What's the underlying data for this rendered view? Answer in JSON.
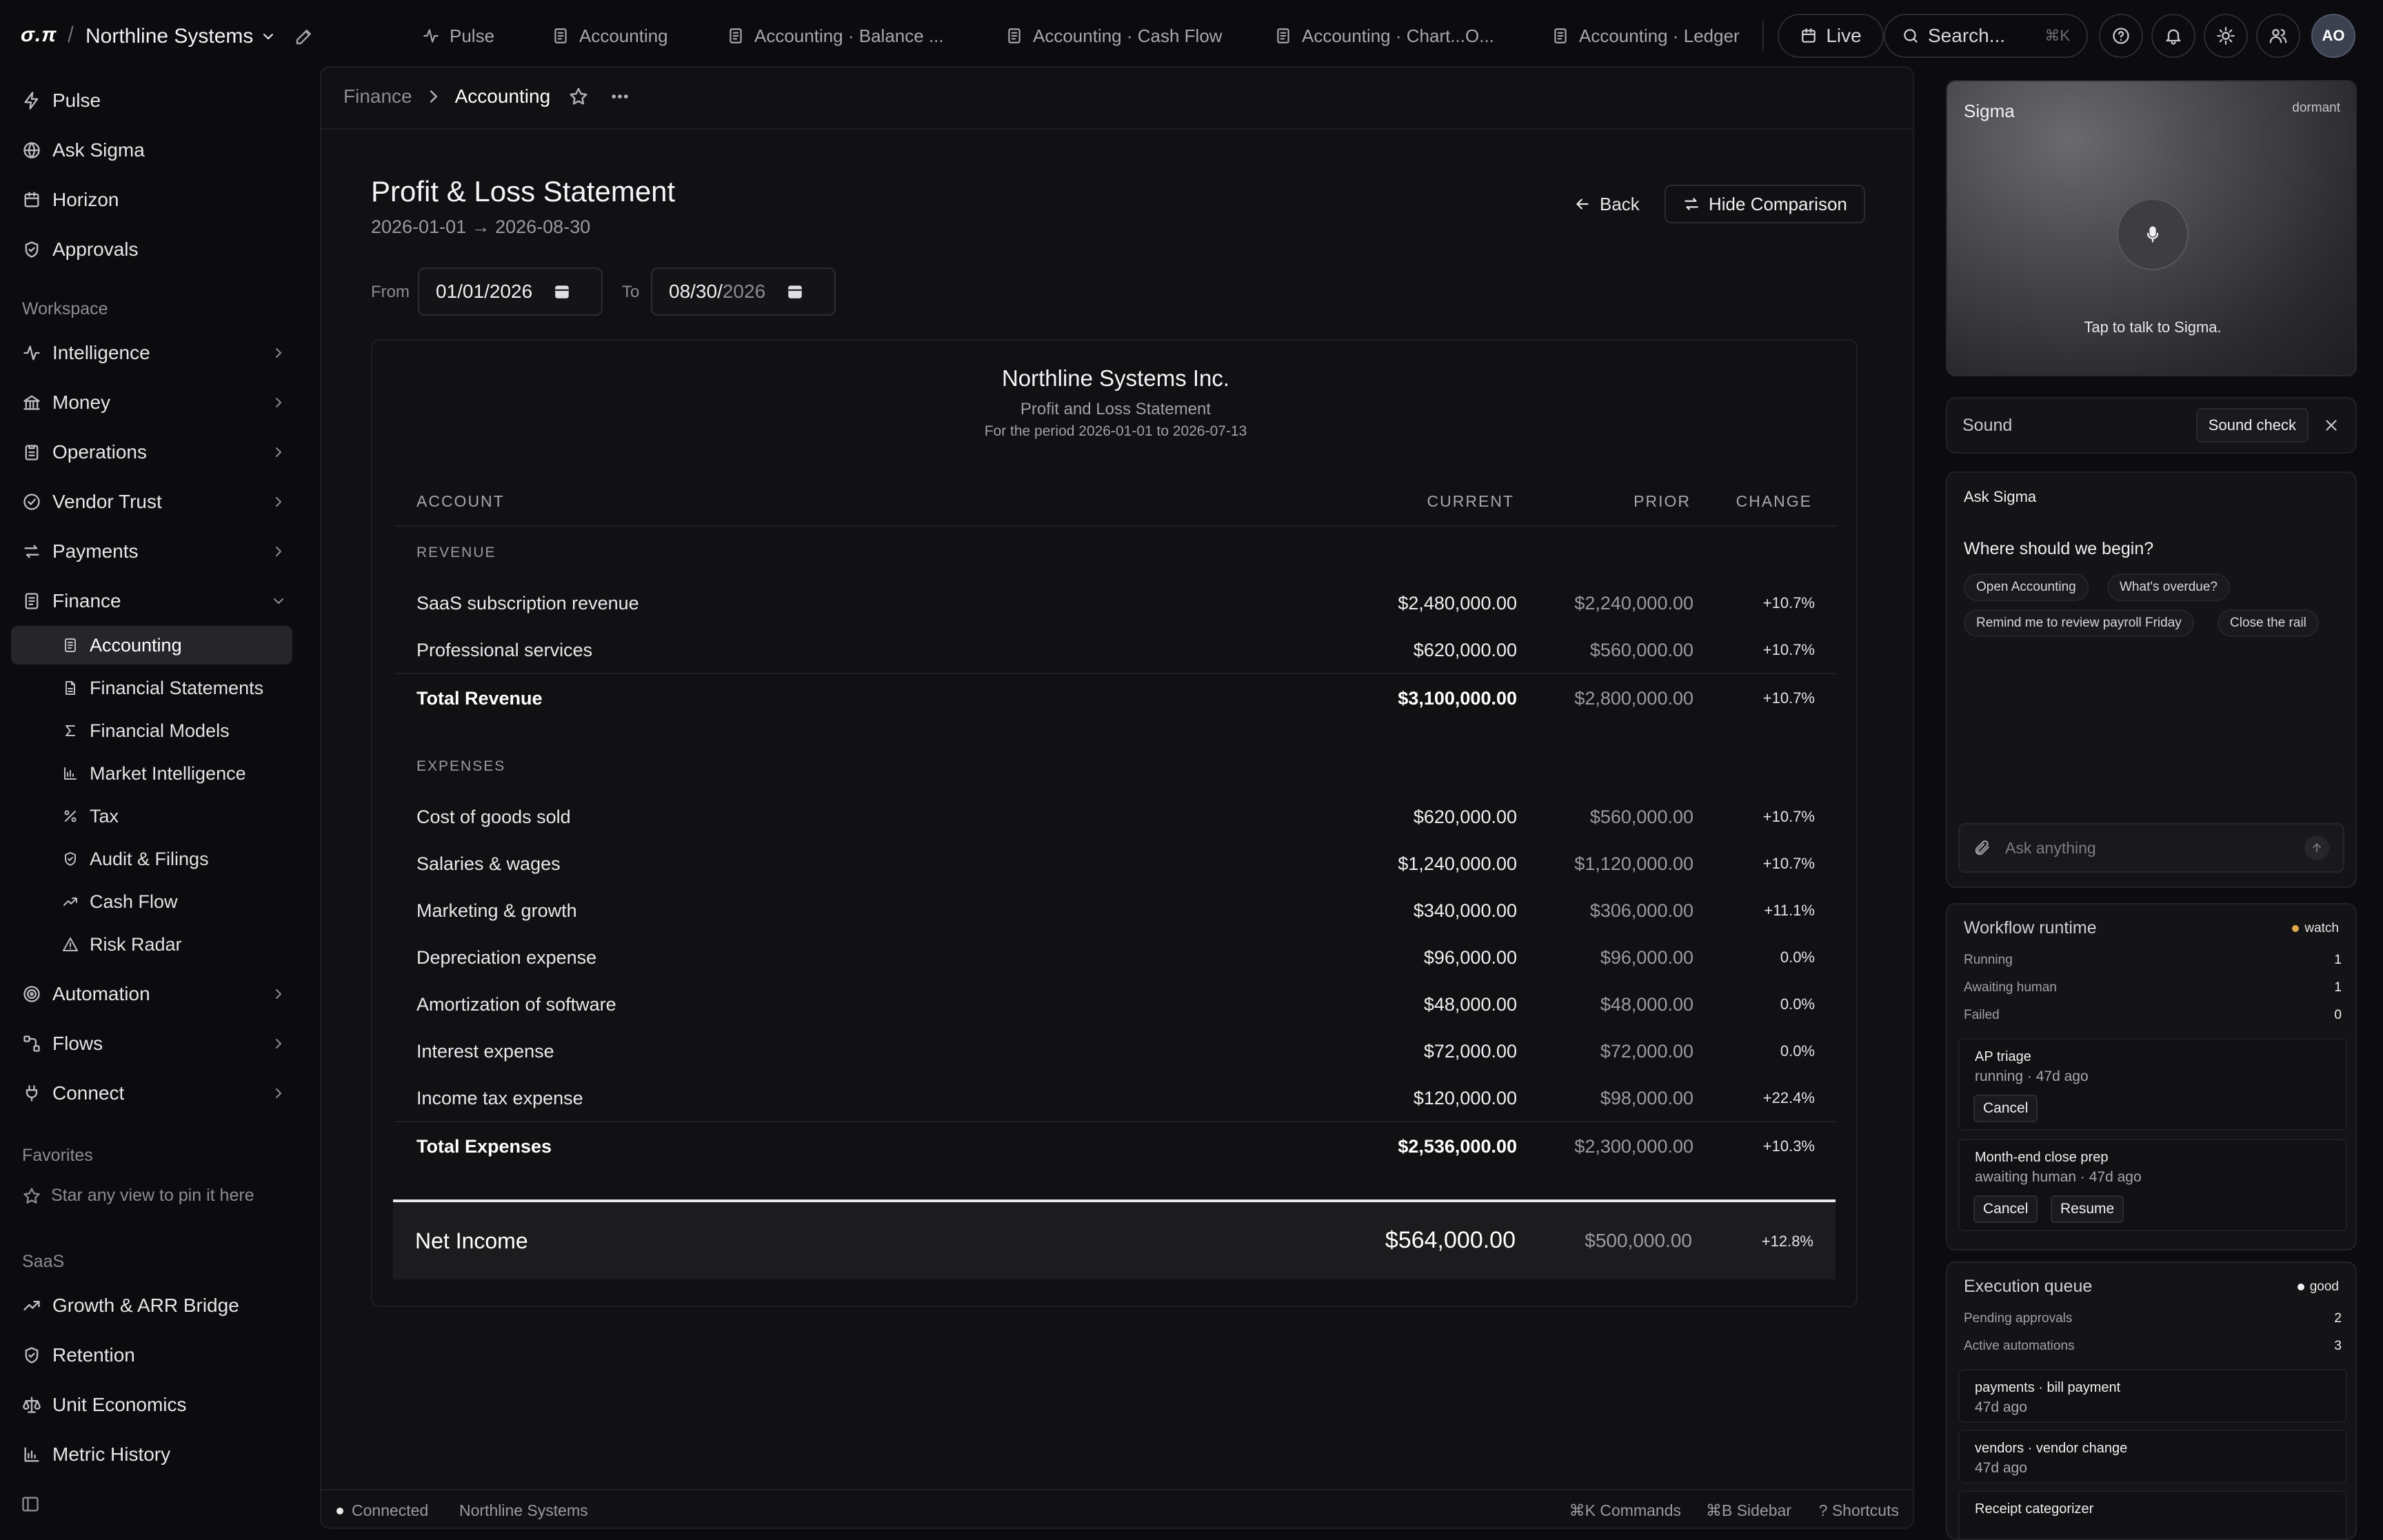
{
  "app": {
    "logo": "σ.π",
    "org": "Northline Systems"
  },
  "tabs": [
    {
      "label": "Pulse",
      "icon": "pulse-icon"
    },
    {
      "label": "Accounting",
      "icon": "document-icon"
    },
    {
      "label": "Accounting · Balance ...",
      "icon": "document-icon"
    },
    {
      "label": "Accounting · Cash Flow",
      "icon": "document-icon"
    },
    {
      "label": "Accounting · Chart...O...",
      "icon": "document-icon"
    },
    {
      "label": "Accounting · Ledger",
      "icon": "document-icon"
    }
  ],
  "topbar": {
    "live_label": "Live",
    "search_placeholder": "Search...",
    "search_shortcut": "⌘K",
    "avatar_initials": "AO"
  },
  "sidebar": {
    "primary": [
      {
        "label": "Pulse",
        "icon": "pulse-icon"
      },
      {
        "label": "Ask Sigma",
        "icon": "globe-icon"
      },
      {
        "label": "Horizon",
        "icon": "calendar-icon"
      },
      {
        "label": "Approvals",
        "icon": "shield-icon"
      }
    ],
    "workspace_label": "Workspace",
    "workspace": [
      {
        "label": "Intelligence",
        "icon": "pulse-icon"
      },
      {
        "label": "Money",
        "icon": "bank-icon"
      },
      {
        "label": "Operations",
        "icon": "clipboard-icon"
      },
      {
        "label": "Vendor Trust",
        "icon": "check-circle-icon"
      },
      {
        "label": "Payments",
        "icon": "transfer-icon"
      },
      {
        "label": "Finance",
        "icon": "document-icon"
      }
    ],
    "finance_children": [
      {
        "label": "Accounting",
        "icon": "document-icon"
      },
      {
        "label": "Financial Statements",
        "icon": "file-icon"
      },
      {
        "label": "Financial Models",
        "icon": "sigma-icon"
      },
      {
        "label": "Market Intelligence",
        "icon": "bar-chart-icon"
      },
      {
        "label": "Tax",
        "icon": "percent-icon"
      },
      {
        "label": "Audit & Filings",
        "icon": "shield-icon"
      },
      {
        "label": "Cash Flow",
        "icon": "trend-icon"
      },
      {
        "label": "Risk Radar",
        "icon": "warning-icon"
      }
    ],
    "more": [
      {
        "label": "Automation",
        "icon": "target-icon"
      },
      {
        "label": "Flows",
        "icon": "flow-icon"
      },
      {
        "label": "Connect",
        "icon": "plug-icon"
      }
    ],
    "favorites_label": "Favorites",
    "favorites_hint": "Star any view to pin it here",
    "saas_label": "SaaS",
    "saas": [
      {
        "label": "Growth & ARR Bridge",
        "icon": "trend-icon"
      },
      {
        "label": "Retention",
        "icon": "shield-icon"
      },
      {
        "label": "Unit Economics",
        "icon": "scale-icon"
      },
      {
        "label": "Metric History",
        "icon": "bar-chart-icon"
      }
    ]
  },
  "breadcrumb": {
    "parent": "Finance",
    "current": "Accounting"
  },
  "page": {
    "title": "Profit & Loss Statement",
    "range": "2026-01-01 → 2026-08-30",
    "back_label": "Back",
    "compare_label": "Hide Comparison",
    "from_label": "From",
    "from_value": "01/01/2026",
    "to_label": "To",
    "to_value_mm": "08/30/",
    "to_value_yyyy": "2026"
  },
  "statement": {
    "company": "Northline Systems Inc.",
    "subtitle": "Profit and Loss Statement",
    "period": "For the period 2026-01-01 to 2026-07-13",
    "columns": {
      "account": "ACCOUNT",
      "current": "CURRENT",
      "prior": "PRIOR",
      "change": "CHANGE"
    },
    "revenue_label": "REVENUE",
    "revenue": [
      {
        "account": "SaaS subscription revenue",
        "current": "$2,480,000.00",
        "prior": "$2,240,000.00",
        "change": "+10.7%"
      },
      {
        "account": "Professional services",
        "current": "$620,000.00",
        "prior": "$560,000.00",
        "change": "+10.7%"
      }
    ],
    "revenue_total": {
      "account": "Total Revenue",
      "current": "$3,100,000.00",
      "prior": "$2,800,000.00",
      "change": "+10.7%"
    },
    "expenses_label": "EXPENSES",
    "expenses": [
      {
        "account": "Cost of goods sold",
        "current": "$620,000.00",
        "prior": "$560,000.00",
        "change": "+10.7%"
      },
      {
        "account": "Salaries & wages",
        "current": "$1,240,000.00",
        "prior": "$1,120,000.00",
        "change": "+10.7%"
      },
      {
        "account": "Marketing & growth",
        "current": "$340,000.00",
        "prior": "$306,000.00",
        "change": "+11.1%"
      },
      {
        "account": "Depreciation expense",
        "current": "$96,000.00",
        "prior": "$96,000.00",
        "change": "0.0%"
      },
      {
        "account": "Amortization of software",
        "current": "$48,000.00",
        "prior": "$48,000.00",
        "change": "0.0%"
      },
      {
        "account": "Interest expense",
        "current": "$72,000.00",
        "prior": "$72,000.00",
        "change": "0.0%"
      },
      {
        "account": "Income tax expense",
        "current": "$120,000.00",
        "prior": "$98,000.00",
        "change": "+22.4%"
      }
    ],
    "expenses_total": {
      "account": "Total Expenses",
      "current": "$2,536,000.00",
      "prior": "$2,300,000.00",
      "change": "+10.3%"
    },
    "net": {
      "account": "Net Income",
      "current": "$564,000.00",
      "prior": "$500,000.00",
      "change": "+12.8%"
    }
  },
  "statusbar": {
    "connection": "Connected",
    "org": "Northline Systems",
    "commands": "⌘K Commands",
    "sidebar": "⌘B Sidebar",
    "shortcuts": "? Shortcuts"
  },
  "rail": {
    "voice": {
      "title": "Sigma",
      "state": "dormant",
      "hint": "Tap to talk to Sigma."
    },
    "sound": {
      "label": "Sound",
      "button": "Sound check"
    },
    "ask": {
      "title": "Ask Sigma",
      "question": "Where should we begin?",
      "chips": [
        "Open Accounting",
        "What's overdue?",
        "Remind me to review payroll Friday",
        "Close the rail"
      ],
      "placeholder": "Ask anything"
    },
    "workflow": {
      "title": "Workflow runtime",
      "status": "watch",
      "status_color": "#e0a848",
      "stats": [
        {
          "label": "Running",
          "value": "1"
        },
        {
          "label": "Awaiting human",
          "value": "1"
        },
        {
          "label": "Failed",
          "value": "0"
        }
      ],
      "items": [
        {
          "name": "AP triage",
          "status": "running · 47d ago",
          "actions": [
            "Cancel"
          ]
        },
        {
          "name": "Month-end close prep",
          "status": "awaiting human · 47d ago",
          "actions": [
            "Cancel",
            "Resume"
          ]
        }
      ]
    },
    "queue": {
      "title": "Execution queue",
      "status": "good",
      "status_color": "#f0f0f2",
      "stats": [
        {
          "label": "Pending approvals",
          "value": "2"
        },
        {
          "label": "Active automations",
          "value": "3"
        }
      ],
      "items": [
        {
          "name": "payments · bill payment",
          "status": "47d ago"
        },
        {
          "name": "vendors · vendor change",
          "status": "47d ago"
        },
        {
          "name": "Receipt categorizer",
          "status": ""
        }
      ]
    }
  }
}
